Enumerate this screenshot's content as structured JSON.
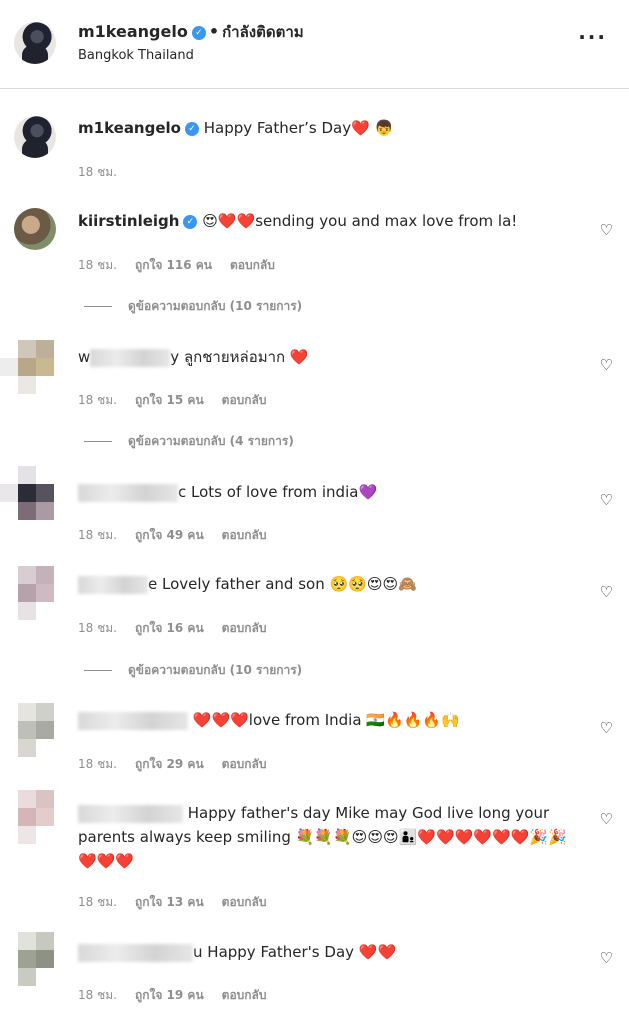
{
  "header": {
    "username": "m1keangelo",
    "follow_status": "กำลังติดตาม",
    "location": "Bangkok Thailand"
  },
  "post": {
    "username": "m1keangelo",
    "caption": "Happy Father’s Day❤️ 👦",
    "time": "18 ชม."
  },
  "comments": [
    {
      "username": "kiirstinleigh",
      "text": "😍❤️❤️sending you and max love from la!",
      "time": "18 ชม.",
      "likes": "ถูกใจ 116 คน",
      "reply": "ตอบกลับ",
      "view_replies": "ดูข้อความตอบกลับ (10 รายการ)"
    },
    {
      "username_visible": "w",
      "username_tail": "y",
      "text": "ลูกชายหล่อมาก ❤️",
      "time": "18 ชม.",
      "likes": "ถูกใจ 15 คน",
      "reply": "ตอบกลับ",
      "view_replies": "ดูข้อความตอบกลับ (4 รายการ)"
    },
    {
      "username_tail": "c",
      "text": "Lots of love from india💜",
      "time": "18 ชม.",
      "likes": "ถูกใจ 49 คน",
      "reply": "ตอบกลับ"
    },
    {
      "username_tail": "e",
      "text": "Lovely father and son 🥺🥺😍😍🙈",
      "time": "18 ชม.",
      "likes": "ถูกใจ 16 คน",
      "reply": "ตอบกลับ",
      "view_replies": "ดูข้อความตอบกลับ (10 รายการ)"
    },
    {
      "text": "❤️❤️❤️love from India 🇮🇳🔥🔥🔥🙌",
      "time": "18 ชม.",
      "likes": "ถูกใจ 29 คน",
      "reply": "ตอบกลับ"
    },
    {
      "text": "Happy father's day Mike may God live long your parents always keep smiling 💐💐💐😍😍😍👨‍👦❤️❤️❤️❤️❤️❤️🎉🎉❤️❤️❤️",
      "time": "18 ชม.",
      "likes": "ถูกใจ 13 คน",
      "reply": "ตอบกลับ"
    },
    {
      "username_tail": "u",
      "text": "Happy Father's Day ❤️❤️",
      "time": "18 ชม.",
      "likes": "ถูกใจ 19 คน",
      "reply": "ตอบกลับ"
    }
  ],
  "icons": {
    "more": "more-options-icon",
    "like": "heart-outline-icon",
    "verified": "verified-badge-icon"
  },
  "colors": {
    "verified": "#3897f0",
    "muted": "#8e8e8e",
    "text": "#262626"
  }
}
